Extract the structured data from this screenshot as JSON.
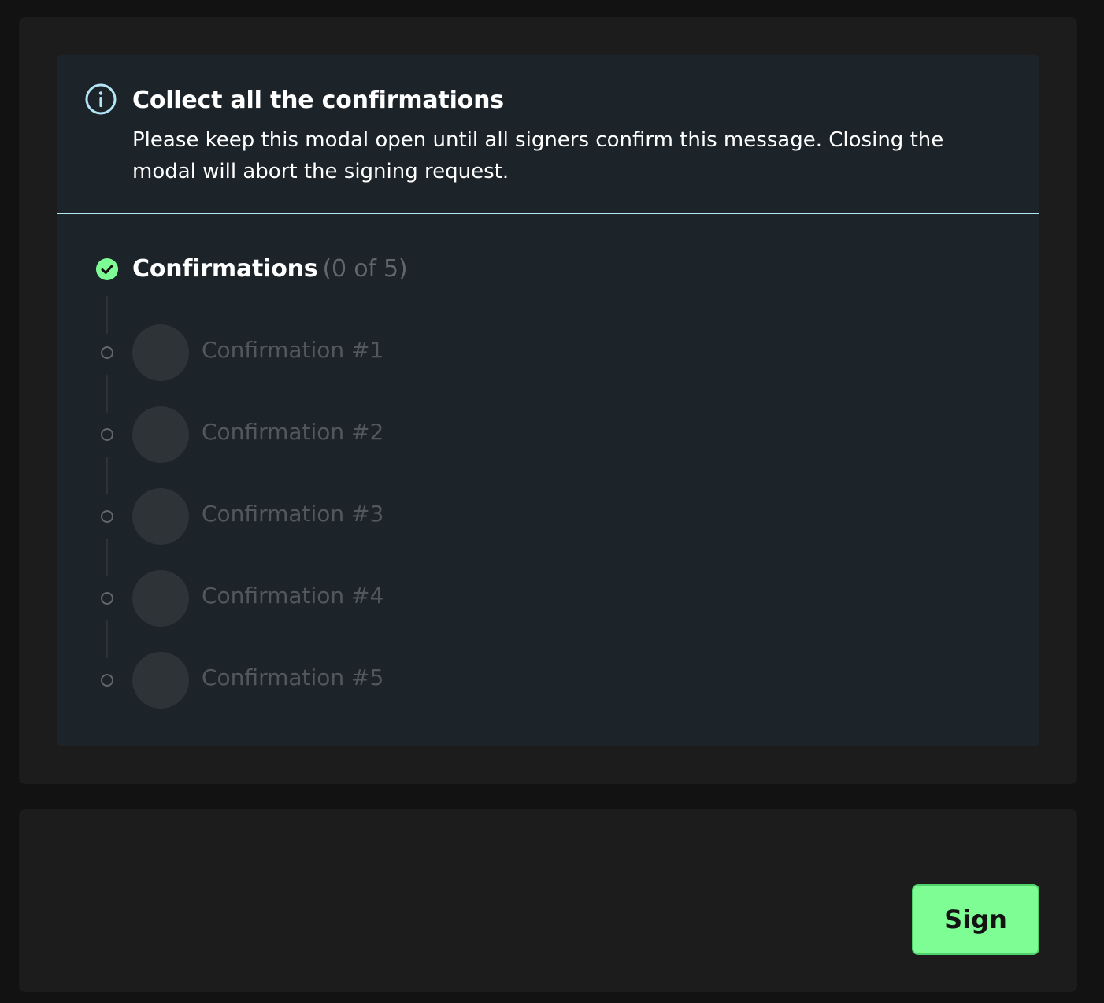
{
  "info": {
    "icon": "info-icon",
    "title": "Collect all the confirmations",
    "text": "Please keep this modal open until all signers confirm this message. Closing the modal will abort the signing request.",
    "accent_color": "#b4e5f7"
  },
  "confirmations": {
    "icon": "check-circle-icon",
    "title": "Confirmations",
    "count": "(0 of 5)",
    "status_color": "#7efd95",
    "items": [
      {
        "label": "Confirmation #1"
      },
      {
        "label": "Confirmation #2"
      },
      {
        "label": "Confirmation #3"
      },
      {
        "label": "Confirmation #4"
      },
      {
        "label": "Confirmation #5"
      }
    ]
  },
  "actions": {
    "sign_label": "Sign",
    "sign_color": "#7efd95"
  }
}
